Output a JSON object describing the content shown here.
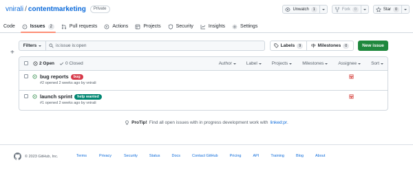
{
  "repo": {
    "owner": "vnirali",
    "slash": "/",
    "name": "contentmarketing",
    "visibility": "Private",
    "actions": {
      "unwatch_label": "Unwatch",
      "unwatch_count": "1",
      "fork_label": "Fork",
      "fork_count": "0",
      "star_label": "Star",
      "star_count": "0"
    }
  },
  "tabs": [
    {
      "label": "Code",
      "icon": "code-icon"
    },
    {
      "label": "Issues",
      "icon": "issue-opened-icon",
      "counter": "2",
      "selected": true
    },
    {
      "label": "Pull requests",
      "icon": "git-pull-request-icon"
    },
    {
      "label": "Actions",
      "icon": "play-icon"
    },
    {
      "label": "Projects",
      "icon": "table-icon"
    },
    {
      "label": "Security",
      "icon": "shield-icon"
    },
    {
      "label": "Insights",
      "icon": "graph-icon"
    },
    {
      "label": "Settings",
      "icon": "gear-icon"
    }
  ],
  "toolbar": {
    "filters_label": "Filters",
    "search_value": "is:issue is:open",
    "labels_label": "Labels",
    "labels_count": "9",
    "milestones_label": "Milestones",
    "milestones_count": "0",
    "new_issue_label": "New issue"
  },
  "issues_header": {
    "open_label": "2 Open",
    "closed_label": "0 Closed",
    "sort_menus": [
      "Author",
      "Label",
      "Projects",
      "Milestones",
      "Assignee",
      "Sort"
    ]
  },
  "issues": [
    {
      "title": "bug reports",
      "label": {
        "name": "bug",
        "bg": "#d73a4a",
        "fg": "#ffffff"
      },
      "meta": "#2 opened 2 weeks ago by vnirali"
    },
    {
      "title": "launch sprint",
      "label": {
        "name": "help wanted",
        "bg": "#008672",
        "fg": "#ffffff"
      },
      "meta": "#1 opened 2 weeks ago by vnirali"
    }
  ],
  "protip": {
    "label": "ProTip!",
    "text": "Find all open issues with in progress development work with",
    "link": "linked:pr",
    "suffix": "."
  },
  "footer": {
    "copyright": "© 2023 GitHub, Inc.",
    "links": [
      "Terms",
      "Privacy",
      "Security",
      "Status",
      "Docs",
      "Contact GitHub",
      "Pricing",
      "API",
      "Training",
      "Blog",
      "About"
    ]
  },
  "colors": {
    "accent": "#0969da",
    "primary_button": "#1f883d",
    "open_issue": "#1a7f37",
    "selected_tab_underline": "#fd8c73"
  }
}
